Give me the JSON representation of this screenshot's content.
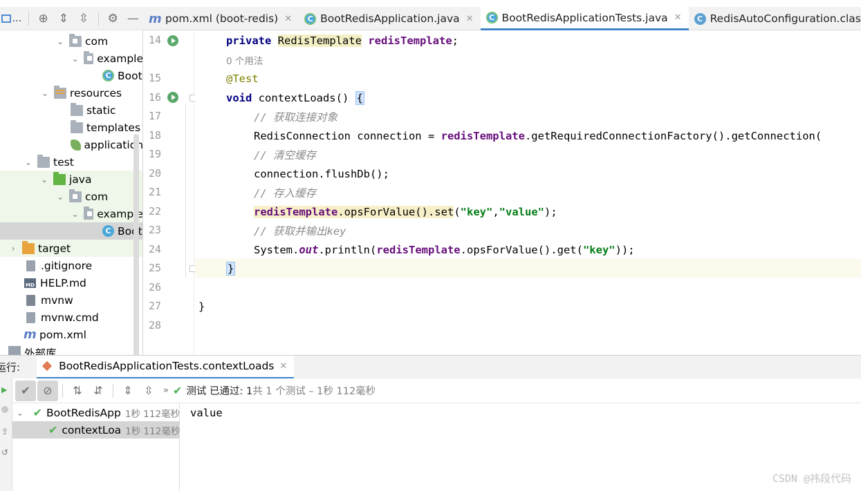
{
  "project": {
    "toolbar": {
      "dots": "..."
    },
    "tree": [
      {
        "label": "com",
        "icon": "package-folder-icon"
      },
      {
        "label": "example",
        "icon": "package-folder-icon"
      },
      {
        "label": "Boot",
        "icon": "spring-class-icon"
      },
      {
        "label": "resources",
        "icon": "resources-folder-icon"
      },
      {
        "label": "static",
        "icon": "folder-icon"
      },
      {
        "label": "templates",
        "icon": "folder-icon"
      },
      {
        "label": "application",
        "icon": "spring-properties-icon"
      },
      {
        "label": "test",
        "icon": "folder-icon"
      },
      {
        "label": "java",
        "icon": "test-sources-folder-icon"
      },
      {
        "label": "com",
        "icon": "package-folder-icon"
      },
      {
        "label": "example",
        "icon": "package-folder-icon"
      },
      {
        "label": "Boot",
        "icon": "test-class-icon"
      },
      {
        "label": "target",
        "icon": "excluded-folder-icon"
      },
      {
        "label": ".gitignore",
        "icon": "gitignore-file-icon"
      },
      {
        "label": "HELP.md",
        "icon": "markdown-file-icon"
      },
      {
        "label": "mvnw",
        "icon": "script-file-icon"
      },
      {
        "label": "mvnw.cmd",
        "icon": "text-file-icon"
      },
      {
        "label": "pom.xml",
        "icon": "maven-icon"
      },
      {
        "label": "外部库",
        "icon": "library-icon"
      }
    ]
  },
  "tabs": [
    {
      "label": "pom.xml (boot-redis)",
      "icon": "maven-icon",
      "active": false
    },
    {
      "label": "BootRedisApplication.java",
      "icon": "spring-class-icon",
      "active": false
    },
    {
      "label": "BootRedisApplicationTests.java",
      "icon": "test-class-icon",
      "active": true
    },
    {
      "label": "RedisAutoConfiguration.class",
      "icon": "class-icon",
      "active": false
    }
  ],
  "editor": {
    "line_numbers": [
      "14",
      "15",
      "16",
      "17",
      "18",
      "19",
      "20",
      "21",
      "22",
      "23",
      "24",
      "25",
      "26",
      "27",
      "28"
    ],
    "usage_hint": "0 个用法",
    "tokens": {
      "private": "private",
      "type": "RedisTemplate",
      "field_decl": "redisTemplate",
      "semi": ";",
      "annotation": "@Test",
      "void": "void",
      "method": " contextLoads() ",
      "open_brace": "{",
      "cmt1": "// 获取连接对象",
      "l18_a": "RedisConnection connection = ",
      "l18_field": "redisTemplate",
      "l18_b": ".getRequiredConnectionFactory().getConnection(",
      "cmt2": "// 清空缓存",
      "l20": "connection.flushDb();",
      "cmt3": "// 存入缓存",
      "l22_field": "redisTemplate",
      "l22_call": ".opsForValue().set",
      "l22_p1": "(",
      "l22_s1": "\"key\"",
      "l22_comma": ",",
      "l22_s2": "\"value\"",
      "l22_end": ");",
      "cmt4": "// 获取并输出key",
      "l24_a": "System.",
      "l24_out": "out",
      "l24_b": ".println(",
      "l24_field": "redisTemplate",
      "l24_c": ".opsForValue().get(",
      "l24_s": "\"key\"",
      "l24_end": "));",
      "close_brace": "}",
      "class_brace": "}"
    }
  },
  "run": {
    "label": "运行:",
    "tab_label": "BootRedisApplicationTests.contextLoads",
    "status_main": "测试 已通过: 1",
    "status_sub": "共 1 个测试 – 1秒 112毫秒",
    "results": [
      {
        "name": "BootRedisApp",
        "duration": "1秒 112毫秒"
      },
      {
        "name": "contextLoa",
        "duration": "1秒 112毫秒"
      }
    ],
    "console_output": "value"
  },
  "watermark": "CSDN @祎段代码",
  "colors": {
    "accent": "#4083c9",
    "pass": "#4caf50",
    "keyword": "#000080",
    "field": "#660e7a",
    "string": "#067d17"
  }
}
